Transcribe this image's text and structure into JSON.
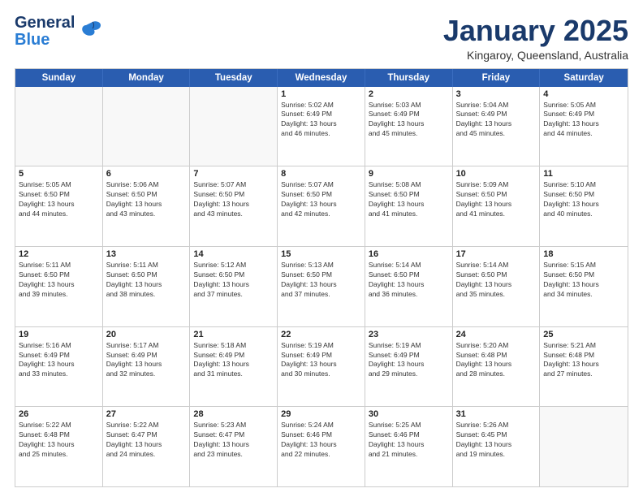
{
  "logo": {
    "line1": "General",
    "line2": "Blue"
  },
  "title": "January 2025",
  "subtitle": "Kingaroy, Queensland, Australia",
  "days_of_week": [
    "Sunday",
    "Monday",
    "Tuesday",
    "Wednesday",
    "Thursday",
    "Friday",
    "Saturday"
  ],
  "weeks": [
    [
      {
        "day": "",
        "info": ""
      },
      {
        "day": "",
        "info": ""
      },
      {
        "day": "",
        "info": ""
      },
      {
        "day": "1",
        "info": "Sunrise: 5:02 AM\nSunset: 6:49 PM\nDaylight: 13 hours\nand 46 minutes."
      },
      {
        "day": "2",
        "info": "Sunrise: 5:03 AM\nSunset: 6:49 PM\nDaylight: 13 hours\nand 45 minutes."
      },
      {
        "day": "3",
        "info": "Sunrise: 5:04 AM\nSunset: 6:49 PM\nDaylight: 13 hours\nand 45 minutes."
      },
      {
        "day": "4",
        "info": "Sunrise: 5:05 AM\nSunset: 6:49 PM\nDaylight: 13 hours\nand 44 minutes."
      }
    ],
    [
      {
        "day": "5",
        "info": "Sunrise: 5:05 AM\nSunset: 6:50 PM\nDaylight: 13 hours\nand 44 minutes."
      },
      {
        "day": "6",
        "info": "Sunrise: 5:06 AM\nSunset: 6:50 PM\nDaylight: 13 hours\nand 43 minutes."
      },
      {
        "day": "7",
        "info": "Sunrise: 5:07 AM\nSunset: 6:50 PM\nDaylight: 13 hours\nand 43 minutes."
      },
      {
        "day": "8",
        "info": "Sunrise: 5:07 AM\nSunset: 6:50 PM\nDaylight: 13 hours\nand 42 minutes."
      },
      {
        "day": "9",
        "info": "Sunrise: 5:08 AM\nSunset: 6:50 PM\nDaylight: 13 hours\nand 41 minutes."
      },
      {
        "day": "10",
        "info": "Sunrise: 5:09 AM\nSunset: 6:50 PM\nDaylight: 13 hours\nand 41 minutes."
      },
      {
        "day": "11",
        "info": "Sunrise: 5:10 AM\nSunset: 6:50 PM\nDaylight: 13 hours\nand 40 minutes."
      }
    ],
    [
      {
        "day": "12",
        "info": "Sunrise: 5:11 AM\nSunset: 6:50 PM\nDaylight: 13 hours\nand 39 minutes."
      },
      {
        "day": "13",
        "info": "Sunrise: 5:11 AM\nSunset: 6:50 PM\nDaylight: 13 hours\nand 38 minutes."
      },
      {
        "day": "14",
        "info": "Sunrise: 5:12 AM\nSunset: 6:50 PM\nDaylight: 13 hours\nand 37 minutes."
      },
      {
        "day": "15",
        "info": "Sunrise: 5:13 AM\nSunset: 6:50 PM\nDaylight: 13 hours\nand 37 minutes."
      },
      {
        "day": "16",
        "info": "Sunrise: 5:14 AM\nSunset: 6:50 PM\nDaylight: 13 hours\nand 36 minutes."
      },
      {
        "day": "17",
        "info": "Sunrise: 5:14 AM\nSunset: 6:50 PM\nDaylight: 13 hours\nand 35 minutes."
      },
      {
        "day": "18",
        "info": "Sunrise: 5:15 AM\nSunset: 6:50 PM\nDaylight: 13 hours\nand 34 minutes."
      }
    ],
    [
      {
        "day": "19",
        "info": "Sunrise: 5:16 AM\nSunset: 6:49 PM\nDaylight: 13 hours\nand 33 minutes."
      },
      {
        "day": "20",
        "info": "Sunrise: 5:17 AM\nSunset: 6:49 PM\nDaylight: 13 hours\nand 32 minutes."
      },
      {
        "day": "21",
        "info": "Sunrise: 5:18 AM\nSunset: 6:49 PM\nDaylight: 13 hours\nand 31 minutes."
      },
      {
        "day": "22",
        "info": "Sunrise: 5:19 AM\nSunset: 6:49 PM\nDaylight: 13 hours\nand 30 minutes."
      },
      {
        "day": "23",
        "info": "Sunrise: 5:19 AM\nSunset: 6:49 PM\nDaylight: 13 hours\nand 29 minutes."
      },
      {
        "day": "24",
        "info": "Sunrise: 5:20 AM\nSunset: 6:48 PM\nDaylight: 13 hours\nand 28 minutes."
      },
      {
        "day": "25",
        "info": "Sunrise: 5:21 AM\nSunset: 6:48 PM\nDaylight: 13 hours\nand 27 minutes."
      }
    ],
    [
      {
        "day": "26",
        "info": "Sunrise: 5:22 AM\nSunset: 6:48 PM\nDaylight: 13 hours\nand 25 minutes."
      },
      {
        "day": "27",
        "info": "Sunrise: 5:22 AM\nSunset: 6:47 PM\nDaylight: 13 hours\nand 24 minutes."
      },
      {
        "day": "28",
        "info": "Sunrise: 5:23 AM\nSunset: 6:47 PM\nDaylight: 13 hours\nand 23 minutes."
      },
      {
        "day": "29",
        "info": "Sunrise: 5:24 AM\nSunset: 6:46 PM\nDaylight: 13 hours\nand 22 minutes."
      },
      {
        "day": "30",
        "info": "Sunrise: 5:25 AM\nSunset: 6:46 PM\nDaylight: 13 hours\nand 21 minutes."
      },
      {
        "day": "31",
        "info": "Sunrise: 5:26 AM\nSunset: 6:45 PM\nDaylight: 13 hours\nand 19 minutes."
      },
      {
        "day": "",
        "info": ""
      }
    ]
  ]
}
